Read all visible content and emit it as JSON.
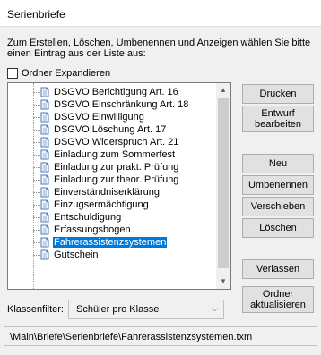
{
  "window": {
    "title": "Serienbriefe"
  },
  "instruction": "Zum Erstellen, Löschen, Umbenennen und Anzeigen wählen Sie bitte einen Eintrag aus der Liste aus:",
  "expand": {
    "label": "Ordner Expandieren",
    "checked": false
  },
  "list": {
    "items": [
      {
        "label": "DSGVO Berichtigung Art. 16",
        "selected": false
      },
      {
        "label": "DSGVO Einschränkung Art. 18",
        "selected": false
      },
      {
        "label": "DSGVO Einwilligung",
        "selected": false
      },
      {
        "label": "DSGVO Löschung Art. 17",
        "selected": false
      },
      {
        "label": "DSGVO Widerspruch Art. 21",
        "selected": false
      },
      {
        "label": "Einladung zum Sommerfest",
        "selected": false
      },
      {
        "label": "Einladung zur prakt. Prüfung",
        "selected": false
      },
      {
        "label": "Einladung zur theor. Prüfung",
        "selected": false
      },
      {
        "label": "Einverständniserklärung",
        "selected": false
      },
      {
        "label": "Einzugsermächtigung",
        "selected": false
      },
      {
        "label": "Entschuldigung",
        "selected": false
      },
      {
        "label": "Erfassungsbogen",
        "selected": false
      },
      {
        "label": "Fahrerassistenzsystemen",
        "selected": true
      },
      {
        "label": "Gutschein",
        "selected": false
      }
    ]
  },
  "buttons": {
    "print": "Drucken",
    "edit_draft": "Entwurf\nbearbeiten",
    "new": "Neu",
    "rename": "Umbenennen",
    "move": "Verschieben",
    "delete": "Löschen",
    "leave": "Verlassen",
    "refresh_folder": "Ordner\naktualisieren"
  },
  "class_filter": {
    "label": "Klassenfilter:",
    "value": "Schüler pro Klasse"
  },
  "path": "\\Main\\Briefe\\Serienbriefe\\Fahrerassistenzsystemen.txm",
  "colors": {
    "selection": "#0078d7",
    "window_bg": "#f0f0f0"
  }
}
